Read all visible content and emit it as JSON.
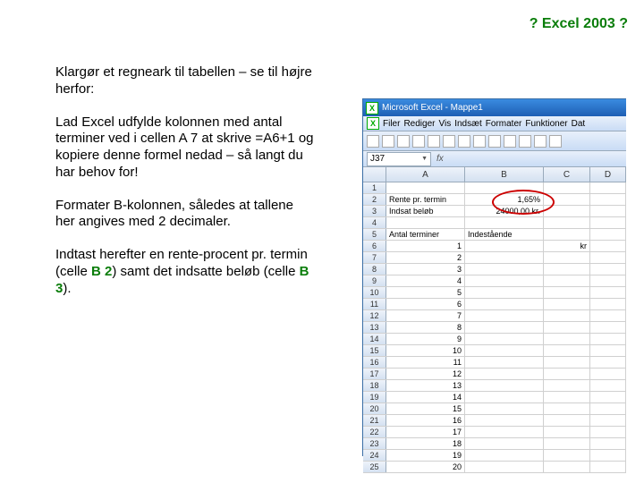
{
  "header": "? Excel 2003 ?",
  "paragraphs": {
    "p1": "Klargør et regneark til tabellen – se til højre herfor:",
    "p2a": "Lad Excel udfylde kolonnen med antal terminer ved i cellen A 7 at skrive =A",
    "p2b": "6+1 og kopiere denne formel nedad – så langt du har behov for!",
    "p3": "Formater B-kolonnen, således at tallene her angives med 2 decimaler.",
    "p4a": "Indtast herefter en rente-procent pr. termin (celle ",
    "ref1": "B 2",
    "p4b": ") samt det indsatte beløb (celle ",
    "ref2": "B 3",
    "p4c": ")."
  },
  "excel": {
    "title": "Microsoft Excel - Mappe1",
    "menu": [
      "Filer",
      "Rediger",
      "Vis",
      "Indsæt",
      "Formater",
      "Funktioner",
      "Dat"
    ],
    "namebox": "J37",
    "cols": [
      "A",
      "B",
      "C",
      "D"
    ],
    "rows": [
      {
        "n": "1",
        "a": "",
        "b": "",
        "c": ""
      },
      {
        "n": "2",
        "a": "Rente pr. termin",
        "b": "1,65%",
        "c": ""
      },
      {
        "n": "3",
        "a": "Indsat beløb",
        "b": "24000,00 kr.",
        "c": ""
      },
      {
        "n": "4",
        "a": "",
        "b": "",
        "c": ""
      },
      {
        "n": "5",
        "a": "Antal terminer",
        "b": "Indestående",
        "c": ""
      },
      {
        "n": "6",
        "a": "1",
        "b": "",
        "c": "kr"
      },
      {
        "n": "7",
        "a": "2",
        "b": "",
        "c": ""
      },
      {
        "n": "8",
        "a": "3",
        "b": "",
        "c": ""
      },
      {
        "n": "9",
        "a": "4",
        "b": "",
        "c": ""
      },
      {
        "n": "10",
        "a": "5",
        "b": "",
        "c": ""
      },
      {
        "n": "11",
        "a": "6",
        "b": "",
        "c": ""
      },
      {
        "n": "12",
        "a": "7",
        "b": "",
        "c": ""
      },
      {
        "n": "13",
        "a": "8",
        "b": "",
        "c": ""
      },
      {
        "n": "14",
        "a": "9",
        "b": "",
        "c": ""
      },
      {
        "n": "15",
        "a": "10",
        "b": "",
        "c": ""
      },
      {
        "n": "16",
        "a": "11",
        "b": "",
        "c": ""
      },
      {
        "n": "17",
        "a": "12",
        "b": "",
        "c": ""
      },
      {
        "n": "18",
        "a": "13",
        "b": "",
        "c": ""
      },
      {
        "n": "19",
        "a": "14",
        "b": "",
        "c": ""
      },
      {
        "n": "20",
        "a": "15",
        "b": "",
        "c": ""
      },
      {
        "n": "21",
        "a": "16",
        "b": "",
        "c": ""
      },
      {
        "n": "22",
        "a": "17",
        "b": "",
        "c": ""
      },
      {
        "n": "23",
        "a": "18",
        "b": "",
        "c": ""
      },
      {
        "n": "24",
        "a": "19",
        "b": "",
        "c": ""
      },
      {
        "n": "25",
        "a": "20",
        "b": "",
        "c": ""
      }
    ]
  }
}
